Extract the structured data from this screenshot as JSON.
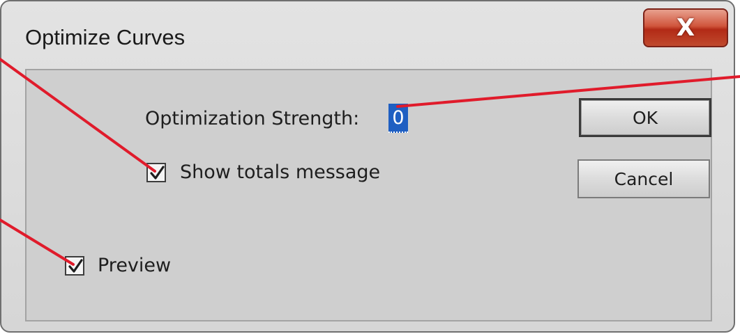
{
  "dialog": {
    "title": "Optimize Curves",
    "close_glyph": "X",
    "close_icon": "close-icon"
  },
  "form": {
    "strength_label": "Optimization Strength:",
    "strength_value": "0",
    "show_totals_label": "Show totals message",
    "show_totals_checked": true,
    "preview_label": "Preview",
    "preview_checked": true
  },
  "buttons": {
    "ok_label": "OK",
    "cancel_label": "Cancel"
  },
  "colors": {
    "callout_line": "#e01b2b",
    "input_selection": "#1f5fc2",
    "close_button": "#c0392b"
  }
}
